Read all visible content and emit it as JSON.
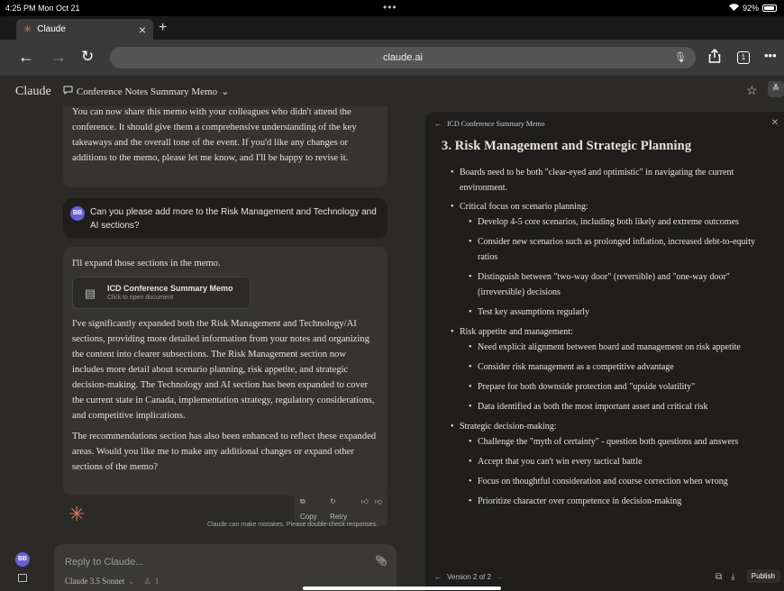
{
  "status": {
    "time": "4:25 PM  Mon Oct 21",
    "dots": "•••",
    "battery": "92%",
    "battery_level": 0.92
  },
  "browser": {
    "tab_title": "Claude",
    "new_tab": "+",
    "url": "claude.ai",
    "tabs_count": "1"
  },
  "app": {
    "logo": "Claude",
    "conversation_title": "Conference Notes Summary Memo",
    "chevron": "⌄"
  },
  "chat": {
    "msg1": "You can now share this memo with your colleagues who didn't attend the conference. It should give them a comprehensive understanding of the key takeaways and the overall tone of the event. If you'd like any changes or additions to the memo, please let me know, and I'll be happy to revise it.",
    "user_initials": "BB",
    "user_msg": "Can you please add more to the Risk Management and Technology and AI sections?",
    "msg2_intro": "I'll expand those sections in the memo.",
    "doc_title": "ICD Conference Summary Memo",
    "doc_sub": "Click to open document",
    "msg2_p1": "I've significantly expanded both the Risk Management and Technology/AI sections, providing more detailed information from your notes and organizing the content into clearer subsections. The Risk Management section now includes more detail about scenario planning, risk appetite, and strategic decision-making. The Technology and AI section has been expanded to cover the current state in Canada, implementation strategy, regulatory considerations, and competitive implications.",
    "msg2_p2": "The recommendations section has also been enhanced to reflect these expanded areas. Would you like me to make any additional changes or expand other sections of the memo?",
    "copy": "Copy",
    "retry": "Retry",
    "disclaimer": "Claude can make mistakes. Please double-check responses."
  },
  "reply": {
    "placeholder": "Reply to Claude...",
    "model": "Claude 3.5 Sonnet",
    "model_chevron": "⌄",
    "count": "1"
  },
  "artifact": {
    "back": "←",
    "title": "ICD Conference Summary Memo",
    "heading": "3. Risk Management and Strategic Planning",
    "b1": "Boards need to be both \"clear-eyed and optimistic\" in navigating the current environment.",
    "b2": "Critical focus on scenario planning:",
    "b2_1": "Develop 4-5 core scenarios, including both likely and extreme outcomes",
    "b2_2": "Consider new scenarios such as prolonged inflation, increased debt-to-equity ratios",
    "b2_3": "Distinguish between \"two-way door\" (reversible) and \"one-way door\" (irreversible) decisions",
    "b2_4": "Test key assumptions regularly",
    "b3": "Risk appetite and management:",
    "b3_1": "Need explicit alignment between board and management on risk appetite",
    "b3_2": "Consider risk management as a competitive advantage",
    "b3_3": "Prepare for both downside protection and \"upside volatility\"",
    "b3_4": "Data identified as both the most important asset and critical risk",
    "b4": "Strategic decision-making:",
    "b4_1": "Challenge the \"myth of certainty\" - question both questions and answers",
    "b4_2": "Accept that you can't win every tactical battle",
    "b4_3": "Focus on thoughtful consideration and course correction when wrong",
    "b4_4": "Prioritize character over competence in decision-making",
    "version": "Version 2 of 2",
    "publish": "Publish"
  }
}
